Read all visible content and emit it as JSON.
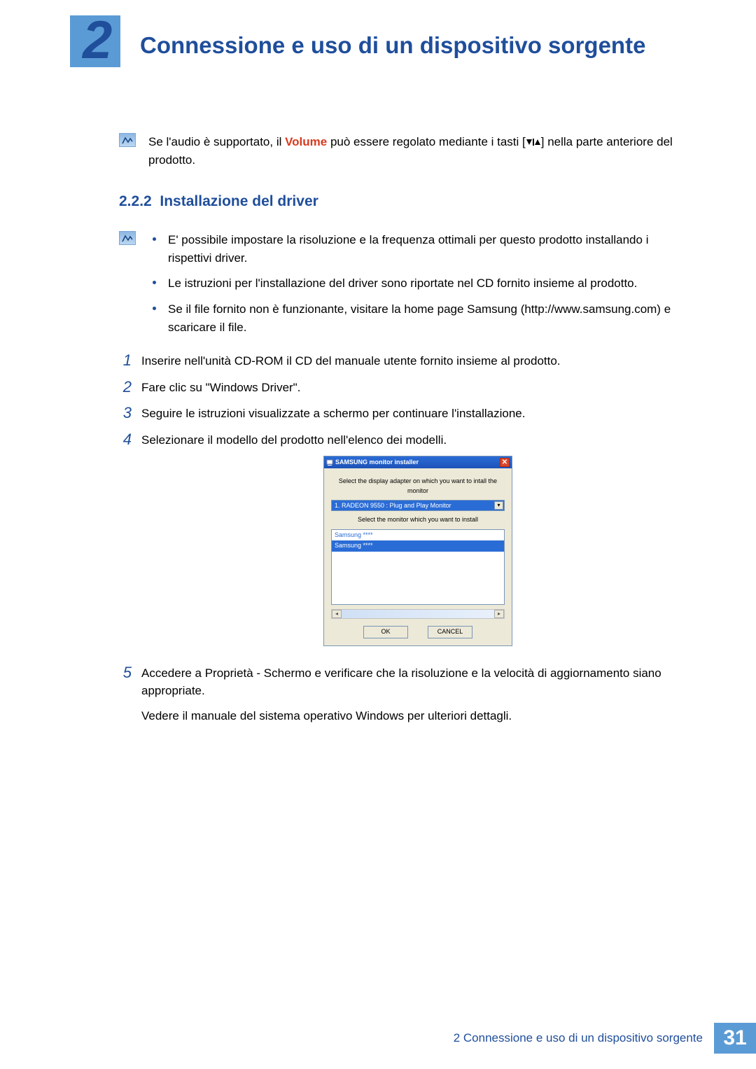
{
  "chapter": {
    "number": "2",
    "title": "Connessione e uso di un dispositivo sorgente"
  },
  "note": {
    "pre_volume": "Se l'audio è supportato, il ",
    "volume_word": "Volume",
    "post_volume_a": " può essere regolato mediante i tasti [",
    "post_volume_b": "] nella parte anteriore del prodotto."
  },
  "section": {
    "number": "2.2.2",
    "title": "Installazione del driver"
  },
  "bullets": [
    "E' possibile impostare la risoluzione e la frequenza ottimali per questo prodotto installando i rispettivi driver.",
    "Le istruzioni per l'installazione del driver sono riportate nel CD fornito insieme al prodotto.",
    "Se il file fornito non è funzionante, visitare la home page Samsung (http://www.samsung.com) e scaricare il file."
  ],
  "steps": {
    "s1": {
      "num": "1",
      "text": "Inserire nell'unità CD-ROM il CD del manuale utente fornito insieme al prodotto."
    },
    "s2": {
      "num": "2",
      "text": "Fare clic su \"Windows Driver\"."
    },
    "s3": {
      "num": "3",
      "text": "Seguire le istruzioni visualizzate a schermo per continuare l'installazione."
    },
    "s4": {
      "num": "4",
      "text": "Selezionare il modello del prodotto nell'elenco dei modelli."
    },
    "s5": {
      "num": "5",
      "text1": "Accedere a Proprietà - Schermo e verificare che la risoluzione e la velocità di aggiornamento siano appropriate.",
      "text2": "Vedere il manuale del sistema operativo Windows per ulteriori dettagli."
    }
  },
  "installer": {
    "title": "SAMSUNG monitor installer",
    "label_adapter": "Select the display adapter on which you want to intall the monitor",
    "adapter_value": "1. RADEON 9550 : Plug and Play Monitor",
    "label_monitor": "Select the monitor which you want to install",
    "monitor_rows": {
      "r1": "Samsung ****",
      "r2": "Samsung ****"
    },
    "ok": "OK",
    "cancel": "CANCEL"
  },
  "footer": {
    "text": "2 Connessione e uso di un dispositivo sorgente",
    "page": "31"
  }
}
